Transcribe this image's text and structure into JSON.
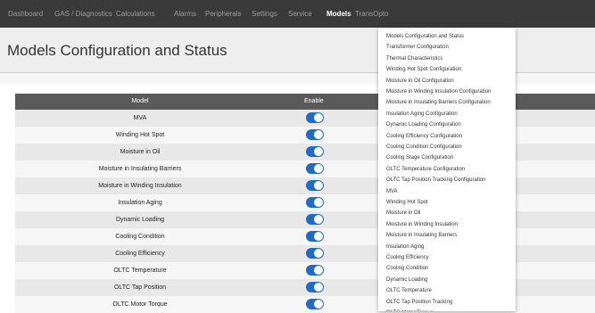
{
  "nav": {
    "items": [
      {
        "label": "Dashboard"
      },
      {
        "label": "GAS / Diagnostics"
      },
      {
        "label": "Calculations"
      },
      {
        "label": "Alarms"
      },
      {
        "label": "Peripherals"
      },
      {
        "label": "Settings"
      },
      {
        "label": "Service"
      },
      {
        "label": "Models",
        "active": true
      },
      {
        "label": "TransOpto"
      }
    ]
  },
  "page": {
    "title": "Models Configuration and Status"
  },
  "table": {
    "headers": {
      "model": "Model",
      "enable": "Enable"
    },
    "rows": [
      {
        "model": "MVA",
        "enabled": true
      },
      {
        "model": "Winding Hot Spot",
        "enabled": true
      },
      {
        "model": "Moisture in Oil",
        "enabled": true
      },
      {
        "model": "Moisture in Insulating Barriers",
        "enabled": true
      },
      {
        "model": "Moisture in Winding Insulation",
        "enabled": true
      },
      {
        "model": "Insulation Aging",
        "enabled": true
      },
      {
        "model": "Dynamic Loading",
        "enabled": true
      },
      {
        "model": "Cooling Condition",
        "enabled": true
      },
      {
        "model": "Cooling Efficiency",
        "enabled": true
      },
      {
        "model": "OLTC Temperature",
        "enabled": true
      },
      {
        "model": "OLTC Tap Position",
        "enabled": true
      },
      {
        "model": "OLTC Motor Torque",
        "enabled": true
      }
    ]
  },
  "dropdown": {
    "items": [
      "Models Configuration and Status",
      "Transformer Configuration",
      "Thermal Characteristics",
      "Winding Hot Spot Configuration",
      "Moisture in Oil Configuration",
      "Moisture in Winding Insulation Configuration",
      "Moisture in Insulating Barriers Configuration",
      "Insulation Aging Configuration",
      "Dynamic Loading Configuration",
      "Cooling Efficiency Configuration",
      "Cooling Condition Configuration",
      "Cooling Stage Configuration",
      "OLTC Temperature Configuration",
      "OLTC Tap Position Tracking Configuration",
      "MVA",
      "Winding Hot Spot",
      "Moisture in Oil",
      "Moisture in Winding Insulation",
      "Moisture in Insulating Barriers",
      "Insulation Aging",
      "Cooling Efficiency",
      "Cooling Condition",
      "Dynamic Loading",
      "OLTC Temperature",
      "OLTC Tap Position Tracking",
      "OLTC Motor Torque"
    ]
  },
  "colors": {
    "navbar": "#3a3a3a",
    "toggle_on": "#1f6bc9",
    "table_header": "#5a5a5a"
  }
}
